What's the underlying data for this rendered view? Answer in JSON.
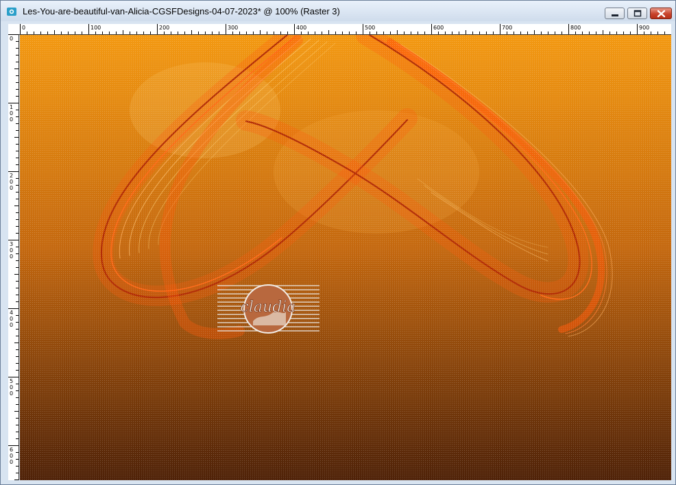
{
  "window": {
    "title": "Les-You-are-beautiful-van-Alicia-CGSFDesigns-04-07-2023* @ 100% (Raster 3)",
    "app_icon": "psp-app-icon",
    "controls": [
      "minimize-icon",
      "maximize-icon",
      "close-icon"
    ]
  },
  "rulers": {
    "horizontal_labels": [
      "0",
      "100",
      "200",
      "300",
      "400",
      "500",
      "600",
      "700",
      "800",
      "900"
    ],
    "vertical_labels": [
      "0",
      "100",
      "200",
      "300",
      "400",
      "500",
      "600"
    ]
  },
  "canvas": {
    "zoom": "100%",
    "layer": "Raster 3",
    "gradient_top": "#f39912",
    "gradient_mid": "#c4680f",
    "gradient_bottom": "#4f2208",
    "ribbon_colors": [
      "#b22c05",
      "#ff5a0a",
      "#ffd27a"
    ]
  },
  "watermark": {
    "text": "claudia",
    "kind": "signature-logo"
  }
}
